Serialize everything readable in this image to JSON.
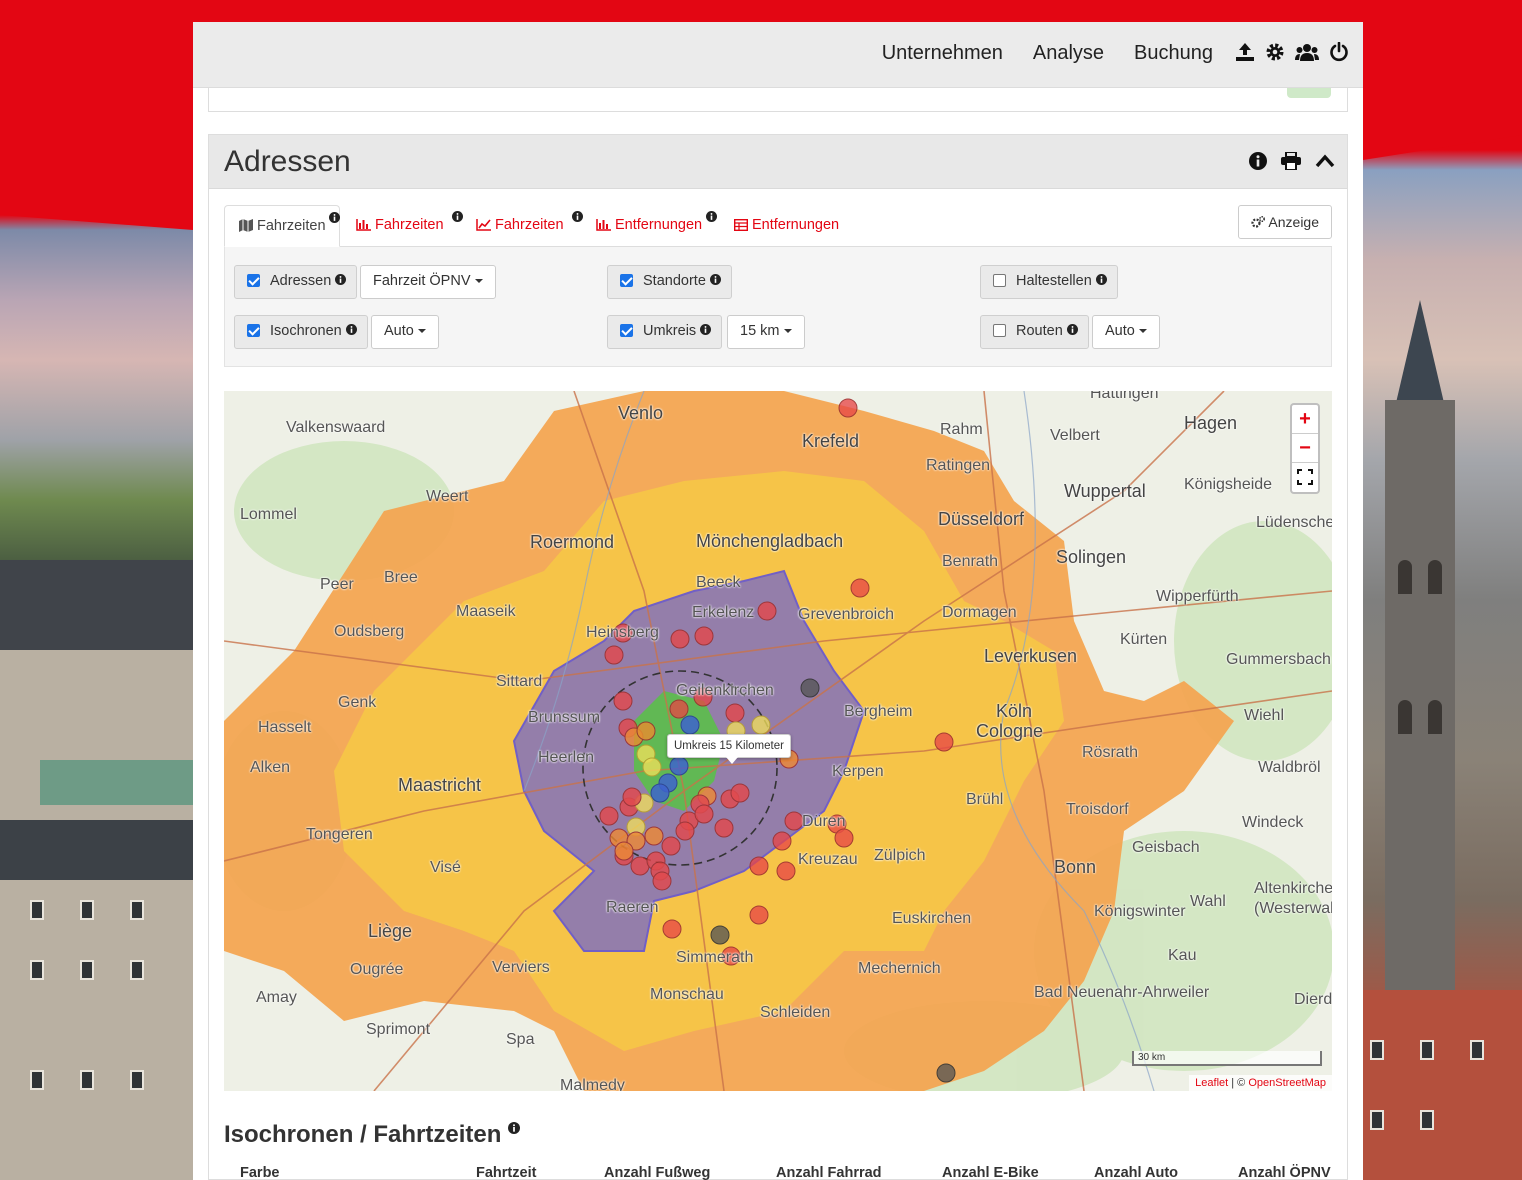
{
  "nav": {
    "links": [
      "Unternehmen",
      "Analyse",
      "Buchung"
    ],
    "icons": [
      "upload-icon",
      "gear-icon",
      "users-icon",
      "power-icon"
    ]
  },
  "panel": {
    "title": "Adressen",
    "tool_icons": [
      "info-icon",
      "print-icon",
      "chevron-up-icon"
    ]
  },
  "tabs": [
    {
      "label": "Fahrzeiten",
      "icon": "map-icon",
      "active": true
    },
    {
      "label": "Fahrzeiten",
      "icon": "bar-chart-icon",
      "active": false
    },
    {
      "label": "Fahrzeiten",
      "icon": "line-chart-icon",
      "active": false
    },
    {
      "label": "Entfernungen",
      "icon": "bar-chart-icon",
      "active": false
    },
    {
      "label": "Entfernungen",
      "icon": "table-icon",
      "active": false
    }
  ],
  "anzeige_label": "Anzeige",
  "filters": {
    "adressen": {
      "label": "Adressen",
      "checked": true,
      "select": "Fahrzeit ÖPNV"
    },
    "isochronen": {
      "label": "Isochronen",
      "checked": true,
      "select": "Auto"
    },
    "standorte": {
      "label": "Standorte",
      "checked": true
    },
    "umkreis": {
      "label": "Umkreis",
      "checked": true,
      "select": "15 km"
    },
    "haltestellen": {
      "label": "Haltestellen",
      "checked": false
    },
    "routen": {
      "label": "Routen",
      "checked": false,
      "select": "Auto"
    }
  },
  "map": {
    "tooltip": "Umkreis 15 Kilometer",
    "scale": "30 km",
    "attribution_leaflet": "Leaflet",
    "attribution_sep": " | © ",
    "attribution_osm": "OpenStreetMap",
    "zoom_in": "+",
    "zoom_out": "−",
    "places": [
      "Venlo",
      "Krefeld",
      "Valkenswaard",
      "Weert",
      "Lommel",
      "Roermond",
      "Mönchengladbach",
      "Düsseldorf",
      "Wuppertal",
      "Solingen",
      "Peer",
      "Bree",
      "Maaseik",
      "Beeck",
      "Grevenbroich",
      "Dormagen",
      "Leverkusen",
      "Heinsberg",
      "Erkelenz",
      "Sittard",
      "Geilenkirchen",
      "Köln",
      "Cologne",
      "Genk",
      "Hasselt",
      "Maastricht",
      "Heerlen",
      "Bergheim",
      "Kerpen",
      "Brühl",
      "Troisdorf",
      "Tongeren",
      "Visé",
      "Düren",
      "Bonn",
      "Liège",
      "Verviers",
      "Raeren",
      "Euskirchen",
      "Königswinter",
      "Simmerath",
      "Monschau",
      "Mechernich",
      "Spa",
      "Schleiden",
      "Bad Neuenahr-Ahrweiler",
      "Malmedy",
      "Hagen",
      "Velbert",
      "Ratingen",
      "Königsheide",
      "Lüdenscheid",
      "Wipperfürth",
      "Kürten",
      "Gummersbach",
      "Wiehl",
      "Rösrath",
      "Waldbröl",
      "Windeck",
      "Geisbach",
      "Altenkirchen (Westerwald)",
      "Wahl",
      "Kau",
      "Dierdorf",
      "Hattingen",
      "Brunssum",
      "Oudsberg",
      "Alken",
      "Ougrée",
      "Amay",
      "Sprimont",
      "Rahm",
      "Benrath",
      "Kreuzau",
      "Zülpich"
    ],
    "marker_colors": {
      "red": "#e84545",
      "orange": "#f28a2e",
      "yellow": "#f2e05a",
      "blue": "#3b5bdb",
      "gray": "#555555"
    },
    "isochrone_colors": {
      "outer": "#f0a04b",
      "middle": "#f5c542",
      "inner": "#8f7bb0",
      "core": "#5bbf4a"
    }
  },
  "isochronen_section": {
    "title": "Isochronen / Fahrtzeiten",
    "columns": [
      "Farbe",
      "Fahrtzeit",
      "Anzahl Fußweg",
      "Anzahl Fahrrad",
      "Anzahl E-Bike",
      "Anzahl Auto",
      "Anzahl ÖPNV"
    ]
  }
}
